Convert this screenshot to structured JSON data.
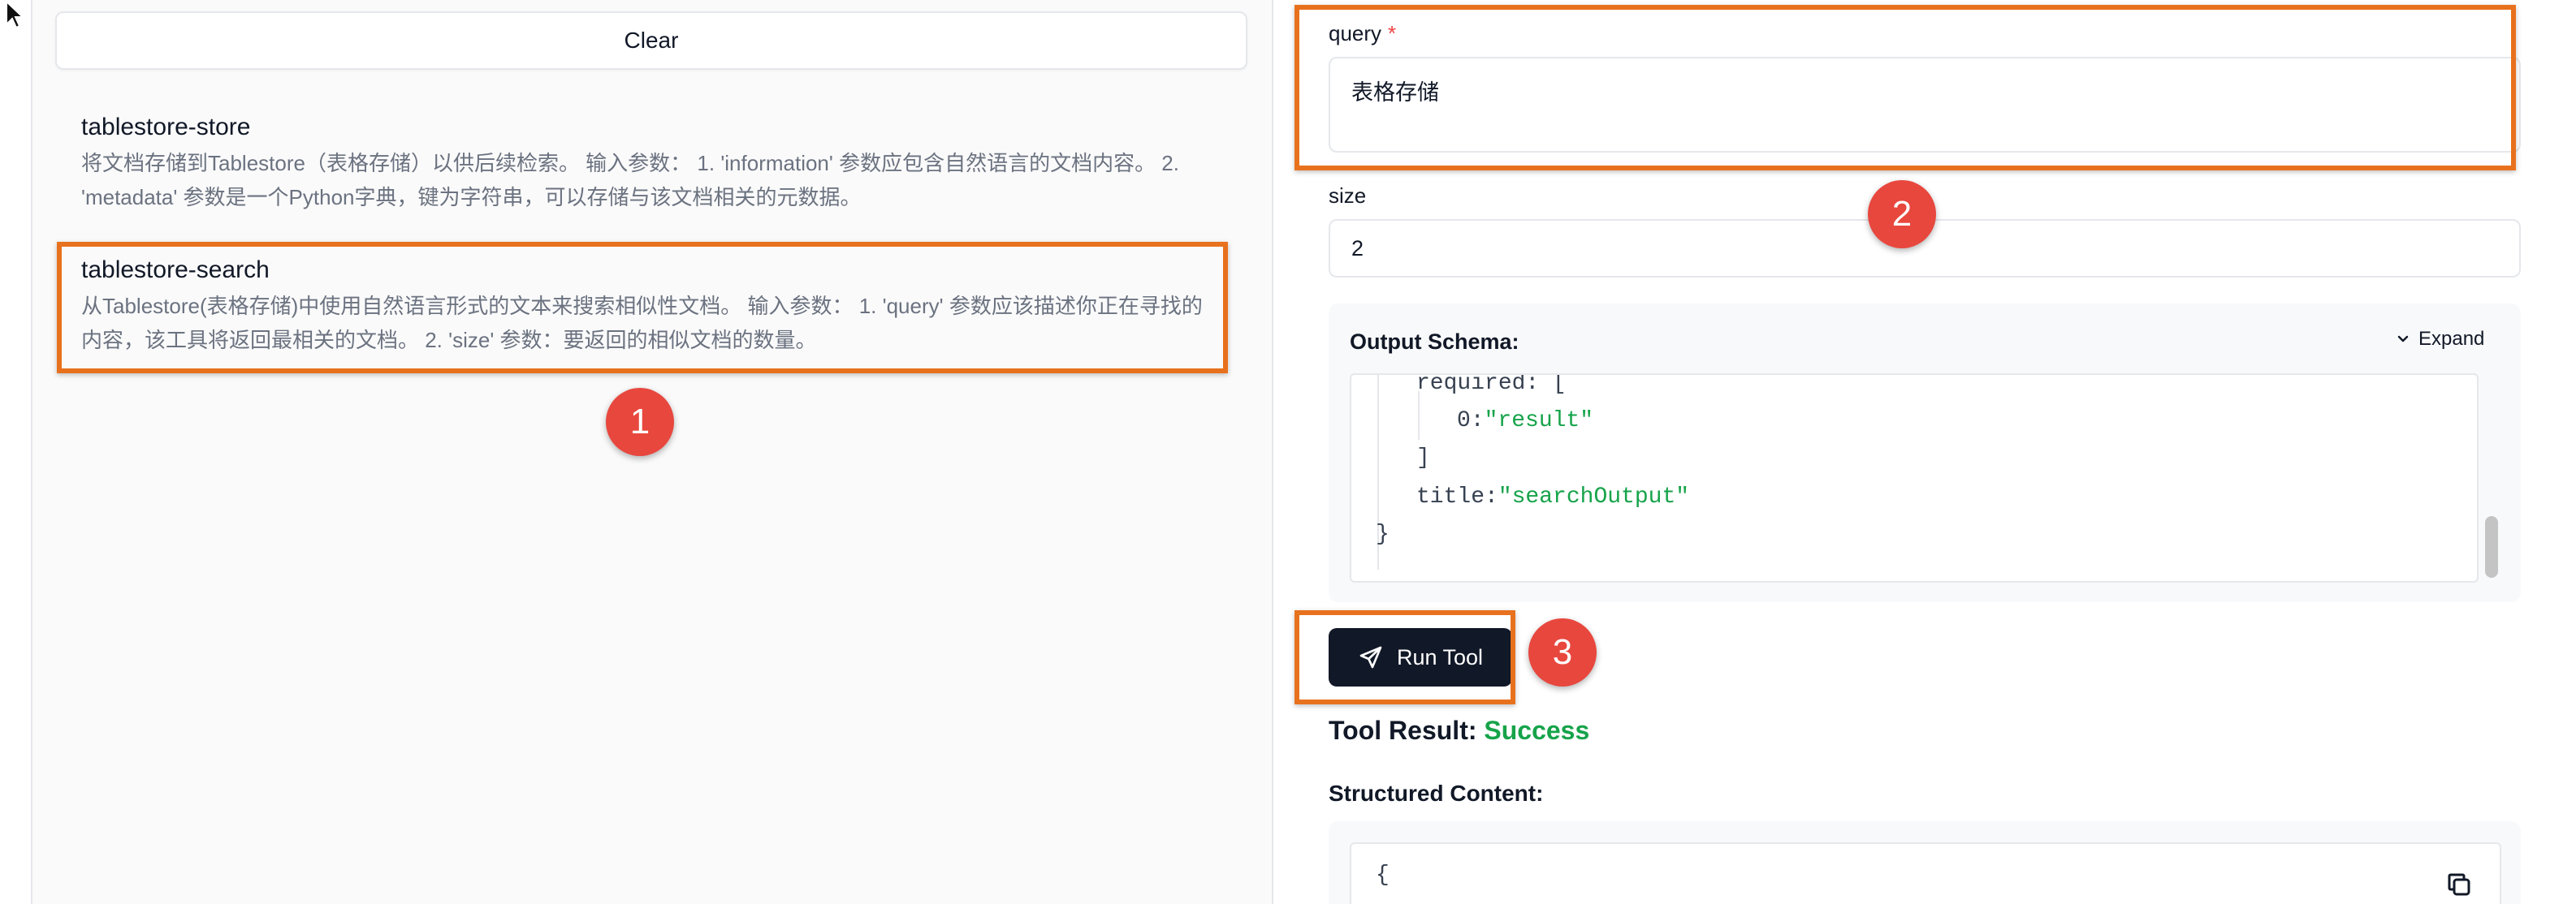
{
  "toolbar": {
    "clear_label": "Clear"
  },
  "tools": [
    {
      "name": "tablestore-store",
      "description": "将文档存储到Tablestore（表格存储）以供后续检索。 输入参数： 1. 'information' 参数应包含自然语言的文档内容。 2. 'metadata' 参数是一个Python字典，键为字符串，可以存储与该文档相关的元数据。"
    },
    {
      "name": "tablestore-search",
      "description": "从Tablestore(表格存储)中使用自然语言形式的文本来搜索相似性文档。 输入参数： 1. 'query' 参数应该描述你正在寻找的内容，该工具将返回最相关的文档。 2. 'size' 参数：要返回的相似文档的数量。"
    }
  ],
  "form": {
    "query_label": "query",
    "required_mark": "*",
    "query_value": "表格存储",
    "size_label": "size",
    "size_value": "2"
  },
  "schema": {
    "title": "Output Schema:",
    "expand_label": "Expand",
    "lines": {
      "required_key": "required:",
      "required_bracket": "[",
      "item_index": "0:",
      "item_value": "\"result\"",
      "close_bracket": "]",
      "title_key": "title:",
      "title_value": "\"searchOutput\"",
      "close_brace": "}"
    }
  },
  "run": {
    "label": "Run Tool"
  },
  "result": {
    "label": "Tool Result:",
    "status": "Success",
    "structured_label": "Structured Content:",
    "open_brace": "{"
  },
  "annotations": {
    "badge1": "1",
    "badge2": "2",
    "badge3": "3"
  },
  "colors": {
    "highlight": "#e8711e",
    "badge": "#e8473e",
    "success": "#16a34a",
    "required": "#ef4444",
    "run_button": "#111827"
  }
}
